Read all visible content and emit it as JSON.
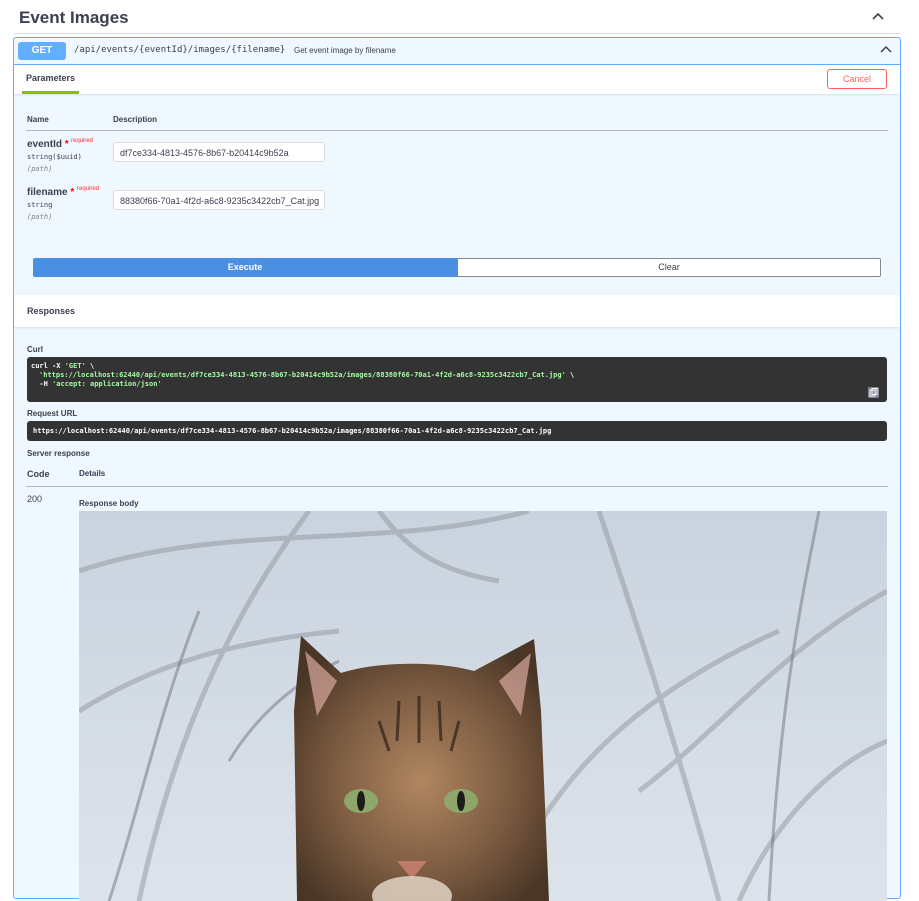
{
  "section": {
    "title": "Event Images"
  },
  "operation": {
    "method": "GET",
    "path": "/api/events/{eventId}/images/{filename}",
    "summary": "Get event image by filename"
  },
  "tabs": {
    "parameters_label": "Parameters",
    "cancel_label": "Cancel"
  },
  "params_table": {
    "name_header": "Name",
    "description_header": "Description"
  },
  "parameters": [
    {
      "name": "eventId",
      "star": "*",
      "required": "required",
      "type": "string($uuid)",
      "in": "(path)",
      "value": "df7ce334-4813-4576-8b67-b20414c9b52a"
    },
    {
      "name": "filename",
      "star": "*",
      "required": "required",
      "type": "string",
      "in": "(path)",
      "value": "88380f66-70a1-4f2d-a6c8-9235c3422cb7_Cat.jpg"
    }
  ],
  "buttons": {
    "execute_label": "Execute",
    "clear_label": "Clear"
  },
  "responses": {
    "title": "Responses",
    "curl_label": "Curl",
    "curl": {
      "line1_cmd": "curl -X ",
      "line1_method": "'GET'",
      "line1_tail": " \\",
      "line2_url": "'https://localhost:62440/api/events/df7ce334-4813-4576-8b67-b20414c9b52a/images/88380f66-70a1-4f2d-a6c8-9235c3422cb7_Cat.jpg'",
      "line2_tail": " \\",
      "line3_cmd": "  -H ",
      "line3_header": "'accept: application/json'"
    },
    "request_url_label": "Request URL",
    "request_url": "https://localhost:62440/api/events/df7ce334-4813-4576-8b67-b20414c9b52a/images/88380f66-70a1-4f2d-a6c8-9235c3422cb7_Cat.jpg",
    "server_response_label": "Server response",
    "code_header": "Code",
    "details_header": "Details",
    "code": "200",
    "response_body_label": "Response body"
  },
  "colors": {
    "get_accent": "#61affe",
    "execute": "#4990e2",
    "cancel": "#ff6060",
    "curl_bg": "#333333",
    "curl_string": "#a2fca2"
  },
  "icons": {
    "section_toggle": "chevron-up-icon",
    "operation_toggle": "chevron-up-icon",
    "copy": "copy-icon"
  }
}
